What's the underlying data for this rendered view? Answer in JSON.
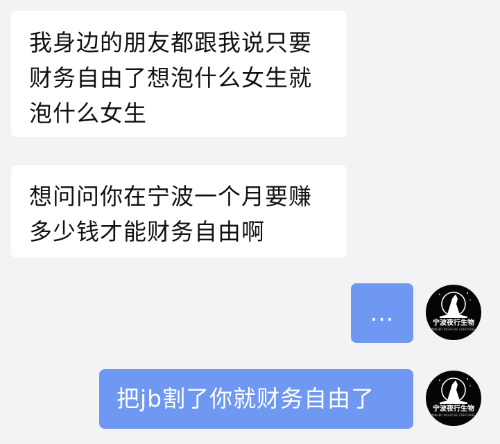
{
  "messages": [
    {
      "side": "incoming",
      "lines": [
        "我身边的朋友都跟我说只要",
        "财务自由了想泡什么女生就",
        "泡什么女生"
      ]
    },
    {
      "side": "incoming",
      "lines": [
        "想问问你在宁波一个月要赚",
        "多少钱才能财务自由啊"
      ]
    },
    {
      "side": "outgoing",
      "text": "..."
    },
    {
      "side": "outgoing",
      "text": "把jb割了你就财务自由了"
    }
  ],
  "avatar": {
    "icon": "night-life-logo-icon",
    "brand_text": "宁波夜行生物",
    "sub_text": "NINGBO NIGHTLIFE CREATURES"
  },
  "colors": {
    "background": "#f3f3f6",
    "incoming_bubble": "#ffffff",
    "outgoing_bubble": "#6f98f2"
  }
}
